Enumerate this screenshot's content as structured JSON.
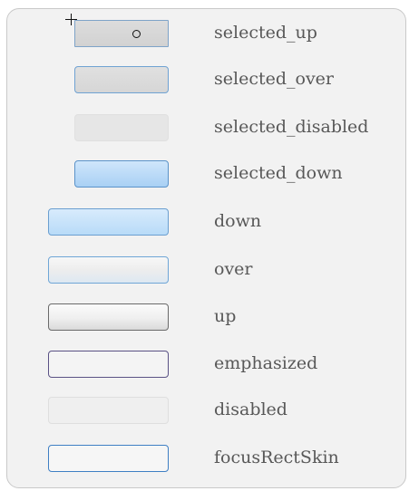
{
  "skins": [
    {
      "key": "selected_up",
      "label": "selected_up"
    },
    {
      "key": "selected_over",
      "label": "selected_over"
    },
    {
      "key": "selected_disabled",
      "label": "selected_disabled"
    },
    {
      "key": "selected_down",
      "label": "selected_down"
    },
    {
      "key": "down",
      "label": "down"
    },
    {
      "key": "over",
      "label": "over"
    },
    {
      "key": "up",
      "label": "up"
    },
    {
      "key": "emphasized",
      "label": "emphasized"
    },
    {
      "key": "disabled",
      "label": "disabled"
    },
    {
      "key": "focusRectSkin",
      "label": "focusRectSkin"
    }
  ],
  "icons": {
    "selected_up_glyph": "circle-icon",
    "cursor": "crosshair-icon"
  },
  "colors": {
    "panel_background": "#f2f2f2",
    "label_text": "#585858",
    "selected_down_fill": "#a9d0f4",
    "emphasized_border": "#5a5285",
    "focus_border": "#3f7fc4"
  }
}
